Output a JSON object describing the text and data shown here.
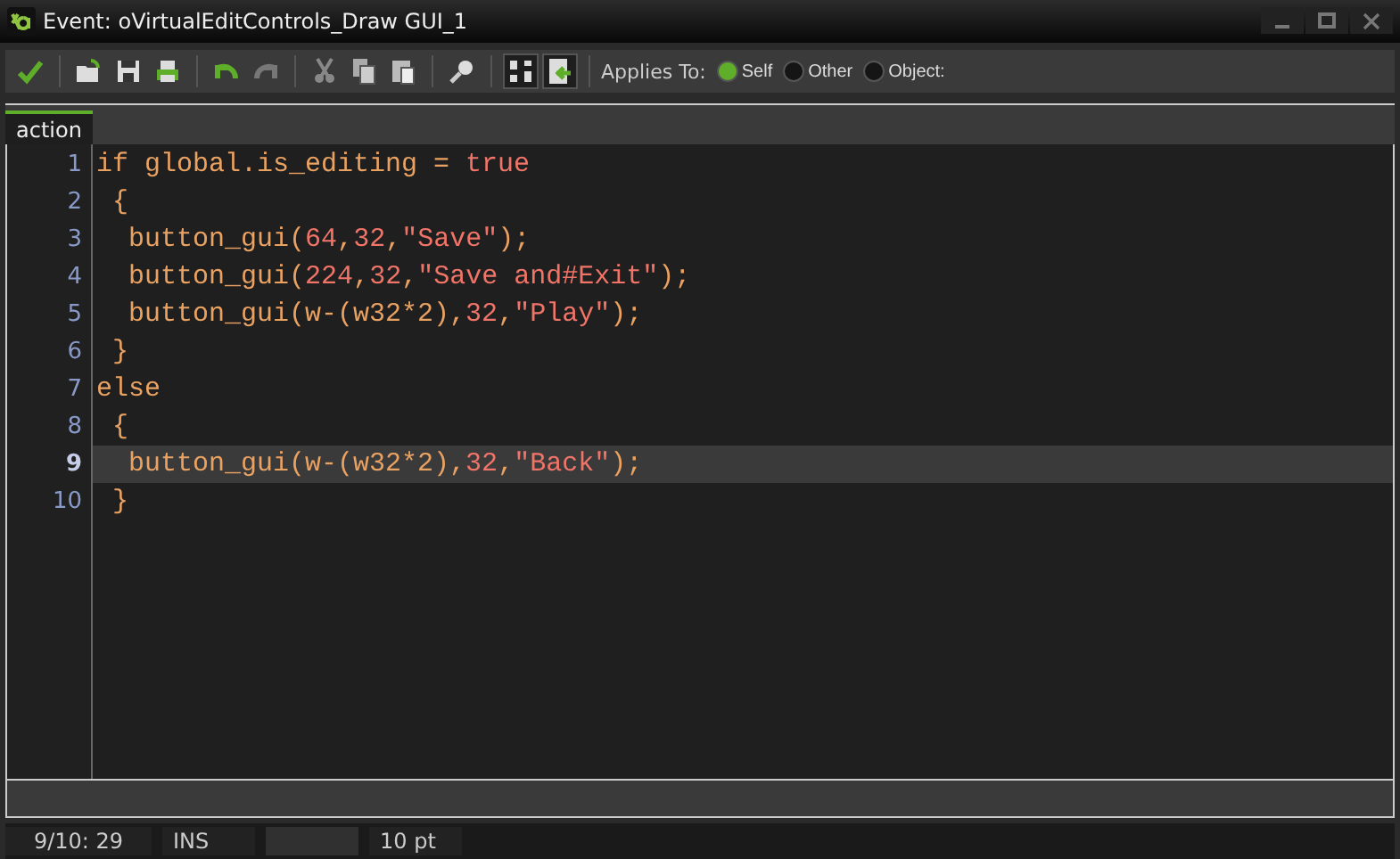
{
  "window": {
    "title": "Event: oVirtualEditControls_Draw GUI_1"
  },
  "toolbar": {
    "applies_to_label": "Applies To:",
    "options": [
      {
        "label": "Self",
        "selected": true
      },
      {
        "label": "Other",
        "selected": false
      },
      {
        "label": "Object:",
        "selected": false
      }
    ]
  },
  "tabs": [
    {
      "label": "action",
      "selected": true
    }
  ],
  "editor": {
    "lines": [
      {
        "number": "1",
        "current": false,
        "tokens": [
          {
            "kind": "code",
            "text": "if global.is_editing = "
          },
          {
            "kind": "literal",
            "text": "true"
          }
        ]
      },
      {
        "number": "2",
        "current": false,
        "tokens": [
          {
            "kind": "code",
            "text": " {"
          }
        ]
      },
      {
        "number": "3",
        "current": false,
        "tokens": [
          {
            "kind": "code",
            "text": "  button_gui("
          },
          {
            "kind": "literal",
            "text": "64"
          },
          {
            "kind": "code",
            "text": ","
          },
          {
            "kind": "literal",
            "text": "32"
          },
          {
            "kind": "code",
            "text": ","
          },
          {
            "kind": "literal",
            "text": "\"Save\""
          },
          {
            "kind": "code",
            "text": ");"
          }
        ]
      },
      {
        "number": "4",
        "current": false,
        "tokens": [
          {
            "kind": "code",
            "text": "  button_gui("
          },
          {
            "kind": "literal",
            "text": "224"
          },
          {
            "kind": "code",
            "text": ","
          },
          {
            "kind": "literal",
            "text": "32"
          },
          {
            "kind": "code",
            "text": ","
          },
          {
            "kind": "literal",
            "text": "\"Save and#Exit\""
          },
          {
            "kind": "code",
            "text": ");"
          }
        ]
      },
      {
        "number": "5",
        "current": false,
        "tokens": [
          {
            "kind": "code",
            "text": "  button_gui(w-(w32*2),"
          },
          {
            "kind": "literal",
            "text": "32"
          },
          {
            "kind": "code",
            "text": ","
          },
          {
            "kind": "literal",
            "text": "\"Play\""
          },
          {
            "kind": "code",
            "text": ");"
          }
        ]
      },
      {
        "number": "6",
        "current": false,
        "tokens": [
          {
            "kind": "code",
            "text": " }"
          }
        ]
      },
      {
        "number": "7",
        "current": false,
        "tokens": [
          {
            "kind": "code",
            "text": "else"
          }
        ]
      },
      {
        "number": "8",
        "current": false,
        "tokens": [
          {
            "kind": "code",
            "text": " {"
          }
        ]
      },
      {
        "number": "9",
        "current": true,
        "tokens": [
          {
            "kind": "code",
            "text": "  button_gui(w-(w32*2),"
          },
          {
            "kind": "literal",
            "text": "32"
          },
          {
            "kind": "code",
            "text": ","
          },
          {
            "kind": "literal",
            "text": "\"Back\""
          },
          {
            "kind": "code",
            "text": ");"
          }
        ]
      },
      {
        "number": "10",
        "current": false,
        "tokens": [
          {
            "kind": "code",
            "text": " }"
          }
        ]
      }
    ]
  },
  "status_bar": [
    "9/10: 29",
    "INS",
    "10 pt"
  ]
}
